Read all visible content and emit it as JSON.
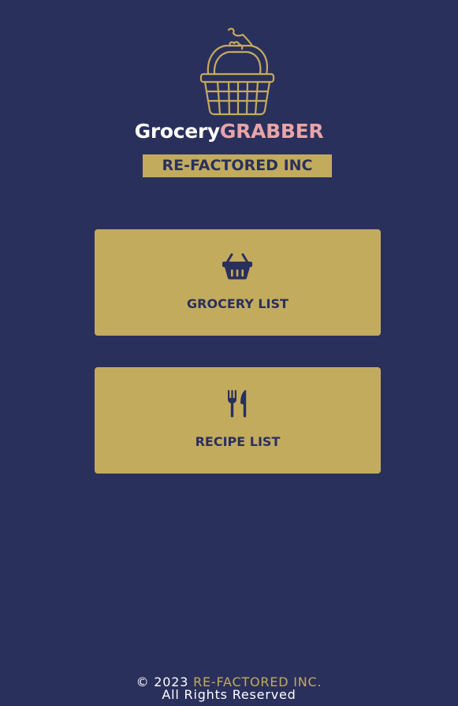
{
  "logo": {
    "brand_part1": "Grocery",
    "brand_part2": "GRABBER",
    "company": "RE-FACTORED INC"
  },
  "menu": {
    "items": [
      {
        "label": "GROCERY LIST",
        "icon": "basket-icon"
      },
      {
        "label": "RECIPE LIST",
        "icon": "utensils-icon"
      }
    ]
  },
  "footer": {
    "copyright": "© 2023",
    "company": "RE-FACTORED INC.",
    "rights": "All Rights Reserved"
  },
  "colors": {
    "background": "#2a305c",
    "gold": "#c3ab5e",
    "pink": "#e8a4a8",
    "white": "#ffffff"
  }
}
